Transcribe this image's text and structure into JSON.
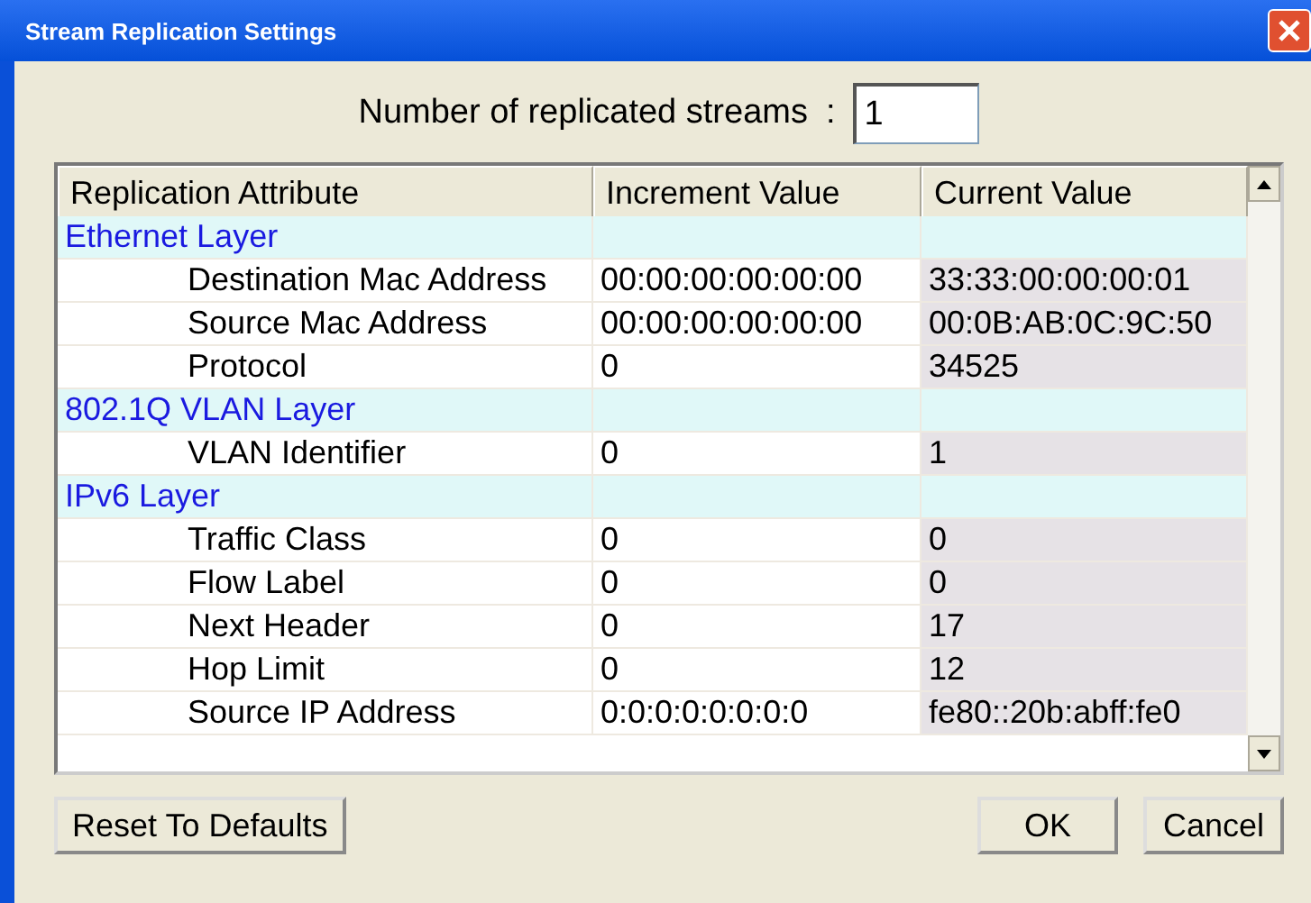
{
  "window": {
    "title": "Stream Replication Settings"
  },
  "streams": {
    "label": "Number of replicated streams",
    "separator": ":",
    "value": "1"
  },
  "table": {
    "columns": [
      "Replication Attribute",
      "Increment Value",
      "Current Value"
    ],
    "layers": [
      {
        "name": "Ethernet Layer",
        "children": [
          {
            "name": "Destination Mac Address",
            "increment": "00:00:00:00:00:00",
            "current": "33:33:00:00:00:01"
          },
          {
            "name": "Source Mac Address",
            "increment": "00:00:00:00:00:00",
            "current": "00:0B:AB:0C:9C:50"
          },
          {
            "name": "Protocol",
            "increment": "0",
            "current": "34525"
          }
        ]
      },
      {
        "name": "802.1Q VLAN Layer",
        "children": [
          {
            "name": "VLAN Identifier",
            "increment": "0",
            "current": "1"
          }
        ]
      },
      {
        "name": "IPv6 Layer",
        "children": [
          {
            "name": "Traffic Class",
            "increment": "0",
            "current": "0"
          },
          {
            "name": "Flow Label",
            "increment": "0",
            "current": "0"
          },
          {
            "name": "Next Header",
            "increment": "0",
            "current": "17"
          },
          {
            "name": "Hop Limit",
            "increment": "0",
            "current": "12"
          },
          {
            "name": "Source IP Address",
            "increment": "0:0:0:0:0:0:0:0",
            "current": "fe80::20b:abff:fe0"
          }
        ]
      }
    ]
  },
  "buttons": {
    "reset": "Reset To Defaults",
    "ok": "OK",
    "cancel": "Cancel"
  }
}
